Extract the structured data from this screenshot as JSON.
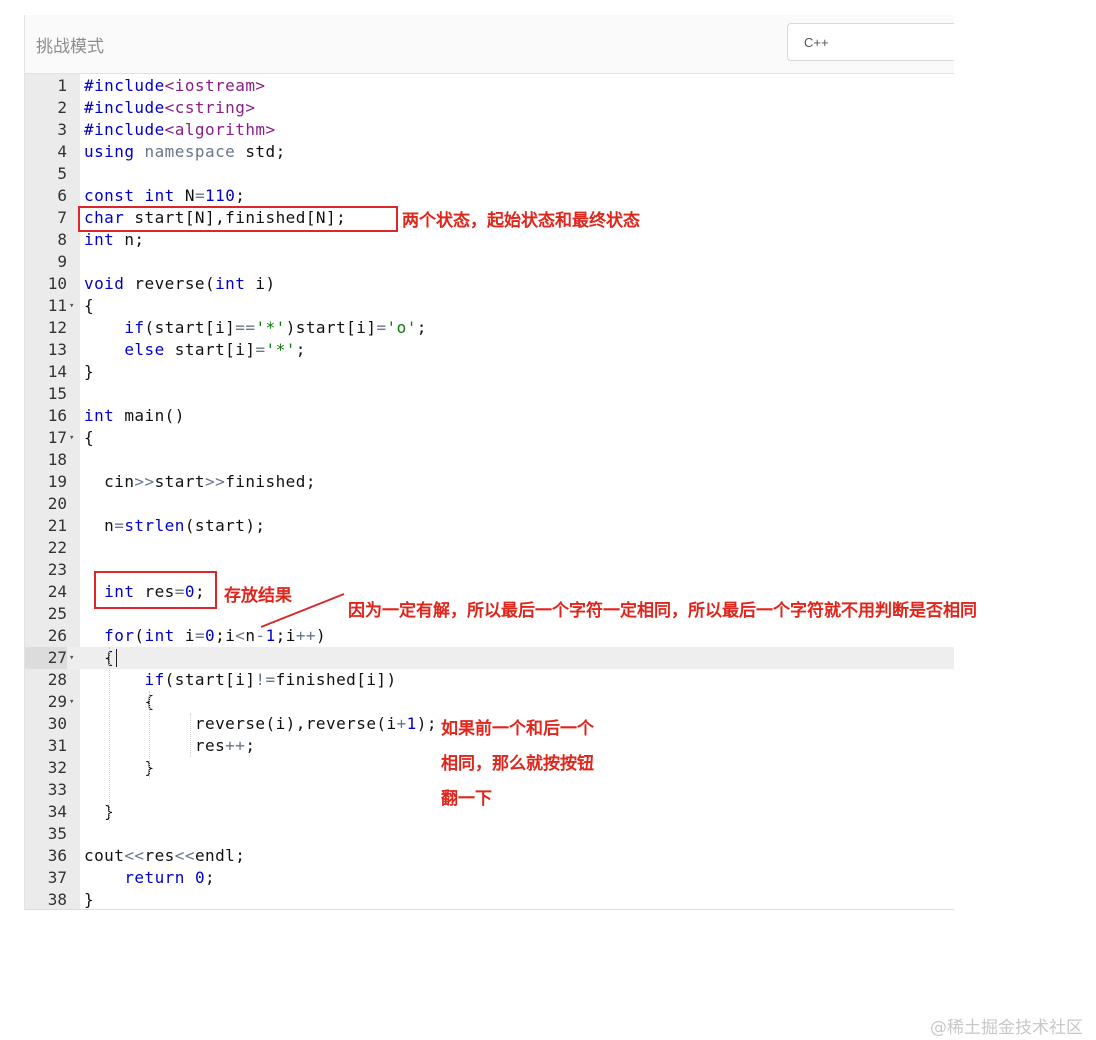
{
  "header": {
    "mode_title": "挑战模式",
    "language": "C++"
  },
  "editor": {
    "active_line": 27,
    "lines": [
      {
        "n": "1",
        "fold": false
      },
      {
        "n": "2",
        "fold": false
      },
      {
        "n": "3",
        "fold": false
      },
      {
        "n": "4",
        "fold": false
      },
      {
        "n": "5",
        "fold": false
      },
      {
        "n": "6",
        "fold": false
      },
      {
        "n": "7",
        "fold": false
      },
      {
        "n": "8",
        "fold": false
      },
      {
        "n": "9",
        "fold": false
      },
      {
        "n": "10",
        "fold": false
      },
      {
        "n": "11",
        "fold": true
      },
      {
        "n": "12",
        "fold": false
      },
      {
        "n": "13",
        "fold": false
      },
      {
        "n": "14",
        "fold": false
      },
      {
        "n": "15",
        "fold": false
      },
      {
        "n": "16",
        "fold": false
      },
      {
        "n": "17",
        "fold": true
      },
      {
        "n": "18",
        "fold": false
      },
      {
        "n": "19",
        "fold": false
      },
      {
        "n": "20",
        "fold": false
      },
      {
        "n": "21",
        "fold": false
      },
      {
        "n": "22",
        "fold": false
      },
      {
        "n": "23",
        "fold": false
      },
      {
        "n": "24",
        "fold": false
      },
      {
        "n": "25",
        "fold": false
      },
      {
        "n": "26",
        "fold": false
      },
      {
        "n": "27",
        "fold": true
      },
      {
        "n": "28",
        "fold": false
      },
      {
        "n": "29",
        "fold": true
      },
      {
        "n": "30",
        "fold": false
      },
      {
        "n": "31",
        "fold": false
      },
      {
        "n": "32",
        "fold": false
      },
      {
        "n": "33",
        "fold": false
      },
      {
        "n": "34",
        "fold": false
      },
      {
        "n": "35",
        "fold": false
      },
      {
        "n": "36",
        "fold": false
      },
      {
        "n": "37",
        "fold": false
      },
      {
        "n": "38",
        "fold": false
      }
    ],
    "code": [
      [
        [
          "meta",
          "#include"
        ],
        [
          "inc",
          "<iostream>"
        ]
      ],
      [
        [
          "meta",
          "#include"
        ],
        [
          "inc",
          "<cstring>"
        ]
      ],
      [
        [
          "meta",
          "#include"
        ],
        [
          "inc",
          "<algorithm>"
        ]
      ],
      [
        [
          "kw",
          "using"
        ],
        [
          "t",
          " "
        ],
        [
          "muted",
          "namespace"
        ],
        [
          "t",
          " std;"
        ]
      ],
      [],
      [
        [
          "kw",
          "const"
        ],
        [
          "t",
          " "
        ],
        [
          "kw",
          "int"
        ],
        [
          "t",
          " N"
        ],
        [
          "op",
          "="
        ],
        [
          "num",
          "110"
        ],
        [
          "t",
          ";"
        ]
      ],
      [
        [
          "kw",
          "char"
        ],
        [
          "t",
          " start[N],finished[N];"
        ]
      ],
      [
        [
          "kw",
          "int"
        ],
        [
          "t",
          " n;"
        ]
      ],
      [],
      [
        [
          "kw",
          "void"
        ],
        [
          "t",
          " reverse("
        ],
        [
          "kw",
          "int"
        ],
        [
          "t",
          " i)"
        ]
      ],
      [
        [
          "t",
          "{"
        ]
      ],
      [
        [
          "t",
          "    "
        ],
        [
          "kw",
          "if"
        ],
        [
          "t",
          "(start[i]"
        ],
        [
          "op",
          "=="
        ],
        [
          "str",
          "'*'"
        ],
        [
          "t",
          ")start[i]"
        ],
        [
          "op",
          "="
        ],
        [
          "str",
          "'o'"
        ],
        [
          "t",
          ";"
        ]
      ],
      [
        [
          "t",
          "    "
        ],
        [
          "kw",
          "else"
        ],
        [
          "t",
          " start[i]"
        ],
        [
          "op",
          "="
        ],
        [
          "str",
          "'*'"
        ],
        [
          "t",
          ";"
        ]
      ],
      [
        [
          "t",
          "}"
        ]
      ],
      [],
      [
        [
          "kw",
          "int"
        ],
        [
          "t",
          " main()"
        ]
      ],
      [
        [
          "t",
          "{"
        ]
      ],
      [],
      [
        [
          "t",
          "  cin"
        ],
        [
          "op",
          ">>"
        ],
        [
          "t",
          "start"
        ],
        [
          "op",
          ">>"
        ],
        [
          "t",
          "finished;"
        ]
      ],
      [],
      [
        [
          "t",
          "  n"
        ],
        [
          "op",
          "="
        ],
        [
          "kw",
          "strlen"
        ],
        [
          "t",
          "(start);"
        ]
      ],
      [],
      [],
      [
        [
          "t",
          "  "
        ],
        [
          "kw",
          "int"
        ],
        [
          "t",
          " res"
        ],
        [
          "op",
          "="
        ],
        [
          "num",
          "0"
        ],
        [
          "t",
          ";"
        ]
      ],
      [],
      [
        [
          "t",
          "  "
        ],
        [
          "kw",
          "for"
        ],
        [
          "t",
          "("
        ],
        [
          "kw",
          "int"
        ],
        [
          "t",
          " i"
        ],
        [
          "op",
          "="
        ],
        [
          "num",
          "0"
        ],
        [
          "t",
          ";i"
        ],
        [
          "op",
          "<"
        ],
        [
          "t",
          "n"
        ],
        [
          "op",
          "-"
        ],
        [
          "num",
          "1"
        ],
        [
          "t",
          ";i"
        ],
        [
          "op",
          "++"
        ],
        [
          "t",
          ")"
        ]
      ],
      [
        [
          "t",
          "  {"
        ]
      ],
      [
        [
          "t",
          "      "
        ],
        [
          "kw",
          "if"
        ],
        [
          "t",
          "(start[i]"
        ],
        [
          "op",
          "!="
        ],
        [
          "t",
          "finished[i])"
        ]
      ],
      [
        [
          "t",
          "      {"
        ]
      ],
      [
        [
          "t",
          "           reverse(i),reverse(i"
        ],
        [
          "op",
          "+"
        ],
        [
          "num",
          "1"
        ],
        [
          "t",
          ");"
        ]
      ],
      [
        [
          "t",
          "           res"
        ],
        [
          "op",
          "++"
        ],
        [
          "t",
          ";"
        ]
      ],
      [
        [
          "t",
          "      }"
        ]
      ],
      [],
      [
        [
          "t",
          "  }"
        ]
      ],
      [],
      [
        [
          "t",
          "cout"
        ],
        [
          "op",
          "<<"
        ],
        [
          "t",
          "res"
        ],
        [
          "op",
          "<<"
        ],
        [
          "t",
          "endl;"
        ]
      ],
      [
        [
          "t",
          "    "
        ],
        [
          "kw",
          "return"
        ],
        [
          "t",
          " "
        ],
        [
          "num",
          "0"
        ],
        [
          "t",
          ";"
        ]
      ],
      [
        [
          "t",
          "}"
        ]
      ]
    ]
  },
  "annotations": {
    "two_states": "两个状态，起始状态和最终状态",
    "store_result": "存放结果",
    "loop_note": "因为一定有解，所以最后一个字符一定相同，所以最后一个字符就不用判断是否相同",
    "flip_note_1": "如果前一个和后一个",
    "flip_note_2": "相同，那么就按按钮",
    "flip_note_3": "翻一下"
  },
  "colors": {
    "annotation_red": "#e0261c",
    "keyword_blue": "#0000c8",
    "string_green": "#0a7a0a"
  },
  "watermark": "@稀土掘金技术社区"
}
